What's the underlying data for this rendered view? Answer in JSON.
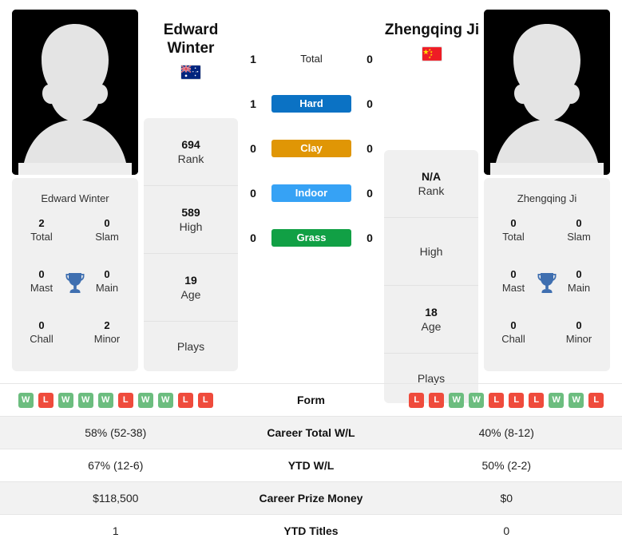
{
  "players": {
    "left": {
      "name_line1": "Edward",
      "name_line2": "Winter",
      "full_name": "Edward Winter",
      "flag": "australia-flag",
      "photo": "player-silhouette",
      "titles": {
        "total_n": "2",
        "total_l": "Total",
        "slam_n": "0",
        "slam_l": "Slam",
        "mast_n": "0",
        "mast_l": "Mast",
        "main_n": "0",
        "main_l": "Main",
        "chall_n": "0",
        "chall_l": "Chall",
        "minor_n": "2",
        "minor_l": "Minor"
      },
      "info": {
        "rank_n": "694",
        "rank_l": "Rank",
        "high_n": "589",
        "high_l": "High",
        "age_n": "19",
        "age_l": "Age",
        "plays_n": "",
        "plays_l": "Plays"
      }
    },
    "right": {
      "name_line1": "Zhengqing Ji",
      "name_line2": "",
      "full_name": "Zhengqing Ji",
      "flag": "china-flag",
      "photo": "player-silhouette",
      "titles": {
        "total_n": "0",
        "total_l": "Total",
        "slam_n": "0",
        "slam_l": "Slam",
        "mast_n": "0",
        "mast_l": "Mast",
        "main_n": "0",
        "main_l": "Main",
        "chall_n": "0",
        "chall_l": "Chall",
        "minor_n": "0",
        "minor_l": "Minor"
      },
      "info": {
        "rank_n": "N/A",
        "rank_l": "Rank",
        "high_n": "",
        "high_l": "High",
        "age_n": "18",
        "age_l": "Age",
        "plays_n": "",
        "plays_l": "Plays"
      }
    }
  },
  "head_to_head": {
    "rows": [
      {
        "label": "Total",
        "left": "1",
        "right": "0",
        "color": "",
        "style": "plain"
      },
      {
        "label": "Hard",
        "left": "1",
        "right": "0",
        "color": "#0b72c4",
        "style": "surface"
      },
      {
        "label": "Clay",
        "left": "0",
        "right": "0",
        "color": "#e09605",
        "style": "surface"
      },
      {
        "label": "Indoor",
        "left": "0",
        "right": "0",
        "color": "#36a2f5",
        "style": "surface"
      },
      {
        "label": "Grass",
        "left": "0",
        "right": "0",
        "color": "#11a045",
        "style": "surface"
      }
    ]
  },
  "stats_table": {
    "form": {
      "label": "Form",
      "left": [
        "W",
        "L",
        "W",
        "W",
        "W",
        "L",
        "W",
        "W",
        "L",
        "L"
      ],
      "right": [
        "L",
        "L",
        "W",
        "W",
        "L",
        "L",
        "L",
        "W",
        "W",
        "L"
      ]
    },
    "rows": [
      {
        "label": "Career Total W/L",
        "left": "58% (52-38)",
        "right": "40% (8-12)"
      },
      {
        "label": "YTD W/L",
        "left": "67% (12-6)",
        "right": "50% (2-2)"
      },
      {
        "label": "Career Prize Money",
        "left": "$118,500",
        "right": "$0"
      },
      {
        "label": "YTD Titles",
        "left": "1",
        "right": "0"
      }
    ]
  },
  "colors": {
    "hard": "#0b72c4",
    "clay": "#e09605",
    "indoor": "#36a2f5",
    "grass": "#11a045",
    "win": "#6cbd7f",
    "loss": "#ef4b3c",
    "card_bg": "#f0f0f0",
    "row_alt": "#f2f2f2"
  }
}
